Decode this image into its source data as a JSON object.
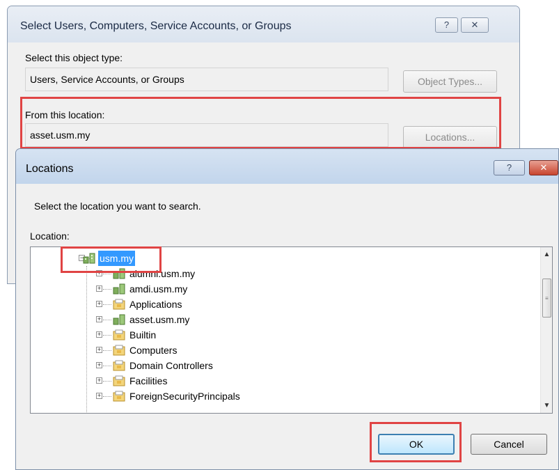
{
  "back_dialog": {
    "title": "Select Users, Computers, Service Accounts, or Groups",
    "help_glyph": "?",
    "close_glyph": "✕",
    "object_type_label": "Select this object type:",
    "object_type_value": "Users, Service Accounts, or Groups",
    "object_types_button": "Object Types...",
    "location_label": "From this location:",
    "location_value": "asset.usm.my",
    "locations_button": "Locations..."
  },
  "locations_dialog": {
    "title": "Locations",
    "help_glyph": "?",
    "close_glyph": "✕",
    "instruction": "Select the location you want to search.",
    "location_label": "Location:",
    "tree": {
      "root": "usm.my",
      "children": [
        "alumni.usm.my",
        "amdi.usm.my",
        "Applications",
        "asset.usm.my",
        "Builtin",
        "Computers",
        "Domain Controllers",
        "Facilities",
        "ForeignSecurityPrincipals"
      ]
    },
    "ok_button": "OK",
    "cancel_button": "Cancel"
  },
  "icons": {
    "domain": "domain-icon",
    "folder": "folder-icon"
  },
  "colors": {
    "highlight_red": "#e04444",
    "selection_blue": "#3399ff",
    "title_blue": "#c2d5ec"
  }
}
